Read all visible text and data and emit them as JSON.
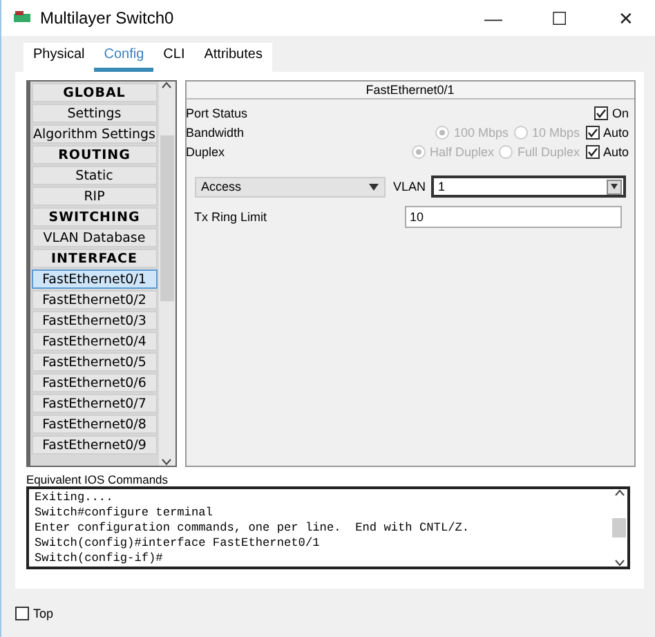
{
  "window": {
    "title": "Multilayer Switch0",
    "controls": [
      "—",
      "☐",
      "✕"
    ]
  },
  "tabs": [
    {
      "label": "Physical",
      "selected": false
    },
    {
      "label": "Config",
      "selected": true
    },
    {
      "label": "CLI",
      "selected": false
    },
    {
      "label": "Attributes",
      "selected": false
    }
  ],
  "sidebar": {
    "items": [
      {
        "kind": "header",
        "label": "GLOBAL",
        "selected": false
      },
      {
        "kind": "item",
        "label": "Settings",
        "selected": false
      },
      {
        "kind": "item",
        "label": "Algorithm Settings",
        "selected": false
      },
      {
        "kind": "header",
        "label": "ROUTING",
        "selected": false
      },
      {
        "kind": "item",
        "label": "Static",
        "selected": false
      },
      {
        "kind": "item",
        "label": "RIP",
        "selected": false
      },
      {
        "kind": "header",
        "label": "SWITCHING",
        "selected": false
      },
      {
        "kind": "item",
        "label": "VLAN Database",
        "selected": false
      },
      {
        "kind": "header",
        "label": "INTERFACE",
        "selected": false
      },
      {
        "kind": "item",
        "label": "FastEthernet0/1",
        "selected": true
      },
      {
        "kind": "item",
        "label": "FastEthernet0/2",
        "selected": false
      },
      {
        "kind": "item",
        "label": "FastEthernet0/3",
        "selected": false
      },
      {
        "kind": "item",
        "label": "FastEthernet0/4",
        "selected": false
      },
      {
        "kind": "item",
        "label": "FastEthernet0/5",
        "selected": false
      },
      {
        "kind": "item",
        "label": "FastEthernet0/6",
        "selected": false
      },
      {
        "kind": "item",
        "label": "FastEthernet0/7",
        "selected": false
      },
      {
        "kind": "item",
        "label": "FastEthernet0/8",
        "selected": false
      },
      {
        "kind": "item",
        "label": "FastEthernet0/9",
        "selected": false
      }
    ]
  },
  "panel": {
    "title": "FastEthernet0/1",
    "port_status": {
      "label": "Port Status",
      "checkbox": {
        "label": "On",
        "checked": true
      }
    },
    "bandwidth": {
      "label": "Bandwidth",
      "options": [
        {
          "label": "100 Mbps",
          "selected": true
        },
        {
          "label": "10 Mbps",
          "selected": false
        }
      ],
      "auto": {
        "label": "Auto",
        "checked": true
      }
    },
    "duplex": {
      "label": "Duplex",
      "options": [
        {
          "label": "Half Duplex",
          "selected": true
        },
        {
          "label": "Full Duplex",
          "selected": false
        }
      ],
      "auto": {
        "label": "Auto",
        "checked": true
      }
    },
    "mode": {
      "value": "Access"
    },
    "vlan": {
      "label": "VLAN",
      "value": "1"
    },
    "tx_ring_limit": {
      "label": "Tx Ring Limit",
      "value": "10"
    }
  },
  "commands": {
    "label": "Equivalent IOS Commands",
    "lines": [
      "Exiting....",
      "Switch#configure terminal",
      "Enter configuration commands, one per line.  End with CNTL/Z.",
      "Switch(config)#interface FastEthernet0/1",
      "Switch(config-if)#"
    ]
  },
  "footer": {
    "top": {
      "label": "Top",
      "checked": false
    }
  }
}
